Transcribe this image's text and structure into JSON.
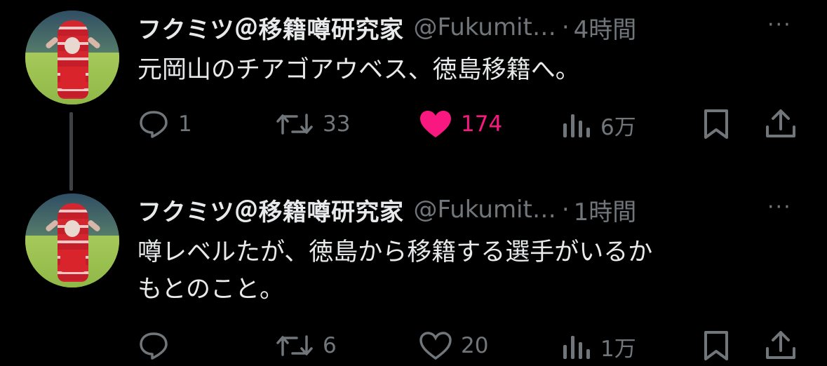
{
  "tweets": [
    {
      "name": "フクミツ＠移籍噂研究家",
      "handle": "@Fukumit…",
      "dot": "·",
      "time": "4時間",
      "more": "···",
      "text": "元岡山のチアゴアウベス、徳島移籍へ。",
      "replies": "1",
      "retweets": "33",
      "likes": "174",
      "liked": true,
      "views": "6万"
    },
    {
      "name": "フクミツ＠移籍噂研究家",
      "handle": "@Fukumit…",
      "dot": "·",
      "time": "1時間",
      "more": "···",
      "text_line1": "噂レベルたが、徳島から移籍する選手がいるか",
      "text_line2": "もとのこと。",
      "replies": "",
      "retweets": "6",
      "likes": "20",
      "liked": false,
      "views": "1万"
    }
  ],
  "colors": {
    "like_active": "#f91880",
    "muted": "#71767b",
    "text": "#e7e9ea",
    "background": "#000000"
  }
}
